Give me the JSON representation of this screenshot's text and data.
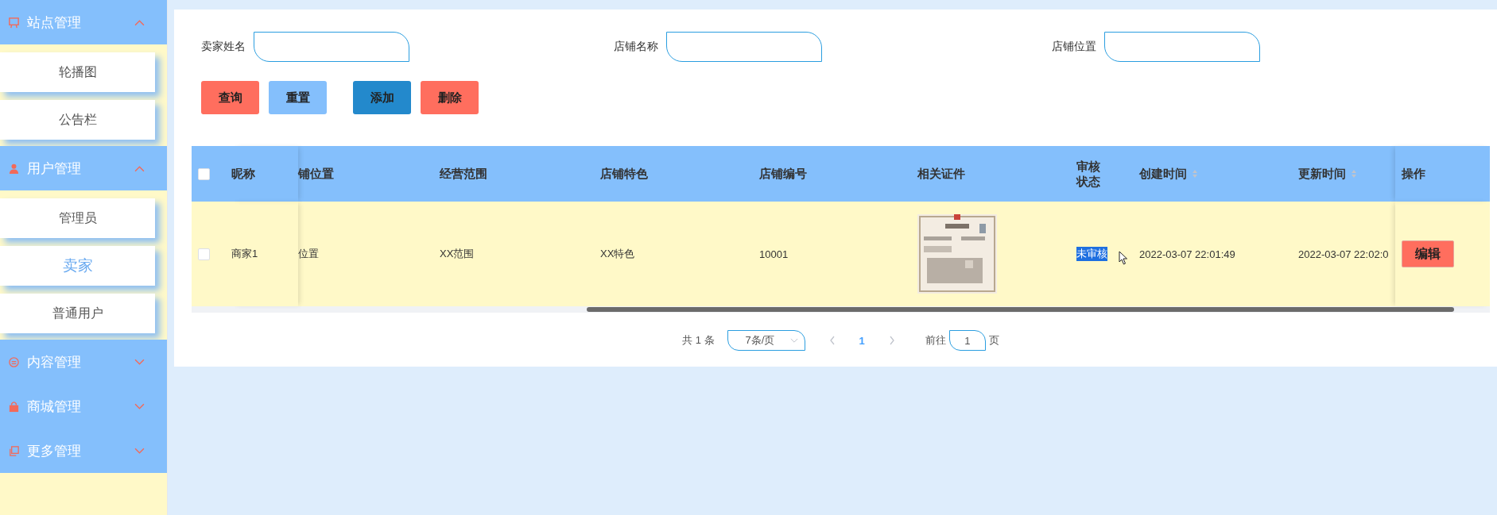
{
  "sidebar": {
    "groups": [
      {
        "label": "站点管理",
        "expanded": true,
        "items": [
          {
            "label": "轮播图",
            "selected": false
          },
          {
            "label": "公告栏",
            "selected": false
          }
        ]
      },
      {
        "label": "用户管理",
        "expanded": true,
        "items": [
          {
            "label": "管理员",
            "selected": false
          },
          {
            "label": "卖家",
            "selected": true
          },
          {
            "label": "普通用户",
            "selected": false
          }
        ]
      },
      {
        "label": "内容管理",
        "expanded": false
      },
      {
        "label": "商城管理",
        "expanded": false
      },
      {
        "label": "更多管理",
        "expanded": false
      }
    ]
  },
  "search": {
    "fields": [
      {
        "label": "卖家姓名"
      },
      {
        "label": "店铺名称"
      },
      {
        "label": "店铺位置"
      }
    ]
  },
  "buttons": [
    {
      "label": "查询",
      "kind": "query"
    },
    {
      "label": "重置",
      "kind": "reset"
    },
    {
      "label": "添加",
      "kind": "add"
    },
    {
      "label": "删除",
      "kind": "delete"
    }
  ],
  "table": {
    "all_checked": false,
    "columns": [
      {
        "label": "昵称",
        "sortable": false
      },
      {
        "label": "铺位置",
        "sortable": false
      },
      {
        "label": "经营范围",
        "sortable": false
      },
      {
        "label": "店铺特色",
        "sortable": false
      },
      {
        "label": "店铺编号",
        "sortable": false
      },
      {
        "label": "相关证件",
        "sortable": false
      },
      {
        "label": "审核状态",
        "sortable": false
      },
      {
        "label": "创建时间",
        "sortable": true
      },
      {
        "label": "更新时间",
        "sortable": true
      },
      {
        "label": "操作",
        "sortable": false
      }
    ],
    "rows": [
      {
        "checked": false,
        "cells": [
          {
            "kind": "text",
            "text": "商家1"
          },
          {
            "kind": "text",
            "text": "位置"
          },
          {
            "kind": "text",
            "text": "XX范围"
          },
          {
            "kind": "text",
            "text": "XX特色"
          },
          {
            "kind": "text",
            "text": "10001"
          },
          {
            "kind": "picture"
          },
          {
            "kind": "status",
            "text": "未审核",
            "highlighted": true
          },
          {
            "kind": "text",
            "text": "2022-03-07 22:01:49"
          },
          {
            "kind": "text",
            "text": "2022-03-07 22:02:0"
          },
          {
            "kind": "button",
            "text": "编辑"
          }
        ]
      }
    ]
  },
  "pagination": {
    "total": "共 1 条",
    "page_size": "7条/页",
    "pages": [
      {
        "label": "1",
        "selected": true
      }
    ],
    "goto_label": "前往",
    "goto_value": "1",
    "goto_suffix": "页"
  }
}
